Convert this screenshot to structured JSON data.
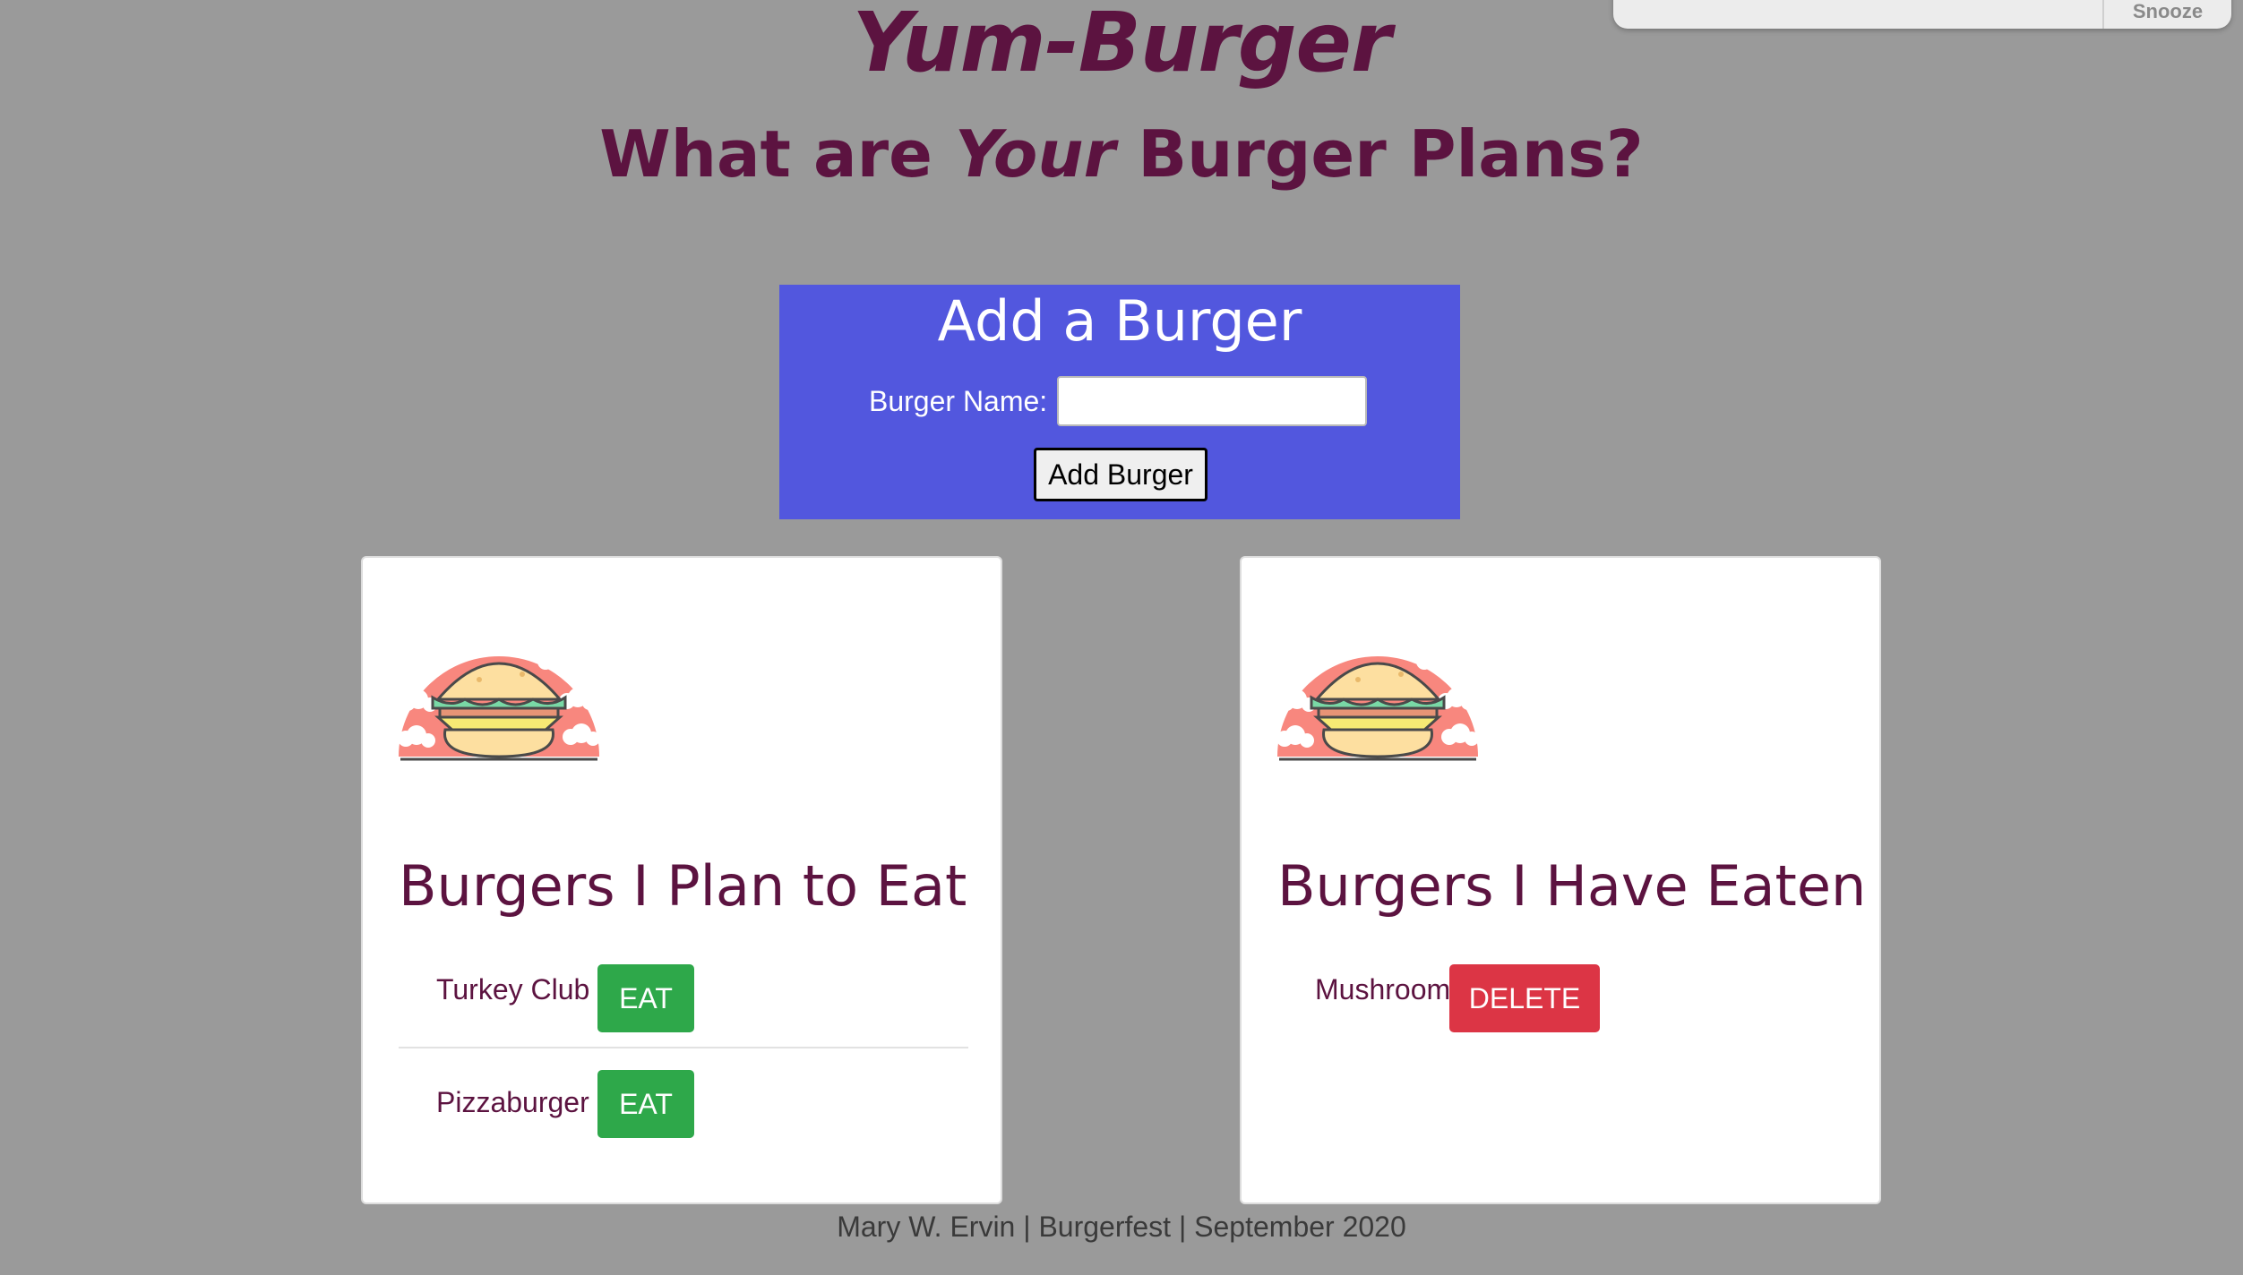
{
  "notification": {
    "snooze_label": "Snooze"
  },
  "header": {
    "title": "Yum-Burger",
    "subtitle_part1": "What are ",
    "subtitle_emphasis": "Your",
    "subtitle_part2": " Burger Plans?"
  },
  "add_form": {
    "title": "Add a Burger",
    "name_label": "Burger Name:",
    "name_value": "",
    "name_placeholder": "",
    "submit_label": "Add Burger"
  },
  "plan_list": {
    "title": "Burgers I Plan to Eat",
    "image_icon": "burger-icon",
    "items": [
      {
        "name": "Turkey Club",
        "action": "EAT"
      },
      {
        "name": "Pizzaburger",
        "action": "EAT"
      }
    ]
  },
  "eaten_list": {
    "title": "Burgers I Have Eaten",
    "image_icon": "burger-icon",
    "items": [
      {
        "name": "Mushroom",
        "action": "DELETE"
      }
    ]
  },
  "footer": {
    "text": "Mary W. Ervin | Burgerfest | September 2020"
  },
  "colors": {
    "background": "#9a9a9a",
    "title_text": "#5c1340",
    "panel_blue": "#5257de",
    "eat_button": "#2ea84a",
    "delete_button": "#dc3545"
  }
}
